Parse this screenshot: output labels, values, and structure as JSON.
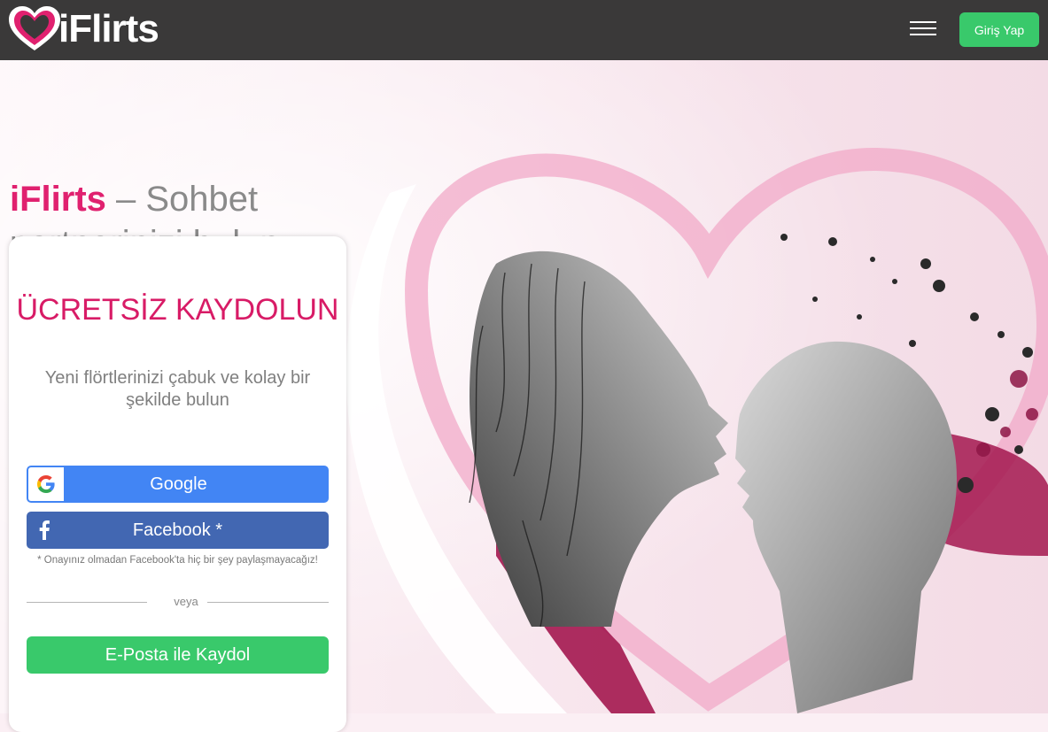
{
  "header": {
    "logo_text": "iFlirts",
    "menu_icon": "hamburger-menu-icon",
    "login_label": "Giriş Yap"
  },
  "hero": {
    "brand": "iFlirts",
    "tagline": " – Sohbet partnerinizi bulun"
  },
  "signup": {
    "title": "ÜCRETSİZ KAYDOLUN",
    "subtitle": "Yeni flörtlerinizi çabuk ve kolay bir şekilde bulun",
    "google_label": "Google",
    "facebook_label": "Facebook *",
    "facebook_note": "* Onayınız olmadan Facebook'ta hiç bir şey paylaşmayacağız!",
    "divider": "veya",
    "email_label": "E-Posta ile Kaydol"
  },
  "colors": {
    "topbar": "#3a3939",
    "brand_pink": "#e0216f",
    "green": "#39c96b",
    "google_blue": "#4285f4",
    "facebook_blue": "#4267b2"
  }
}
